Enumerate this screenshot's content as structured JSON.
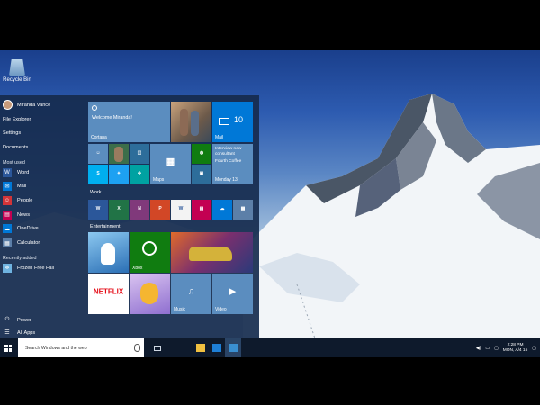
{
  "desktop": {
    "recycle_bin_label": "Recycle Bin"
  },
  "start_menu": {
    "user_name": "Miranda Vance",
    "places": [
      "File Explorer",
      "Settings",
      "Documents"
    ],
    "most_used_header": "Most used",
    "most_used": [
      {
        "label": "Word",
        "icon": "word-icon",
        "color": "#2b579a"
      },
      {
        "label": "Mail",
        "icon": "mail-icon",
        "color": "#0078d7"
      },
      {
        "label": "People",
        "icon": "people-icon",
        "color": "#d13438"
      },
      {
        "label": "News",
        "icon": "news-icon",
        "color": "#c30052"
      },
      {
        "label": "OneDrive",
        "icon": "onedrive-icon",
        "color": "#0078d7"
      },
      {
        "label": "Calculator",
        "icon": "calculator-icon",
        "color": "#5c7fa8"
      }
    ],
    "recently_added_header": "Recently added",
    "recently_added": [
      {
        "label": "Frozen Free Fall",
        "icon": "frozen-icon"
      }
    ],
    "power_label": "Power",
    "all_apps_label": "All Apps"
  },
  "tiles": {
    "cortana": {
      "greeting": "Welcome Miranda!",
      "label": "Cortana",
      "color": "#5b8dbf"
    },
    "mail": {
      "label": "Mail",
      "count": "10",
      "color": "#0078d7"
    },
    "maps_label": "Maps",
    "news_headline": "Interview new consultant",
    "news_sub": "Fourth Coffee",
    "calendar_day": "Monday 13",
    "work_header": "Work",
    "entertainment_header": "Entertainment",
    "xbox_label": "Xbox",
    "netflix_label": "NETFLIX",
    "music_label": "Music",
    "video_label": "Video"
  },
  "taskbar": {
    "search_placeholder": "Search Windows and the web",
    "time": "2:28 PM",
    "date": "MON, A/4 15"
  }
}
